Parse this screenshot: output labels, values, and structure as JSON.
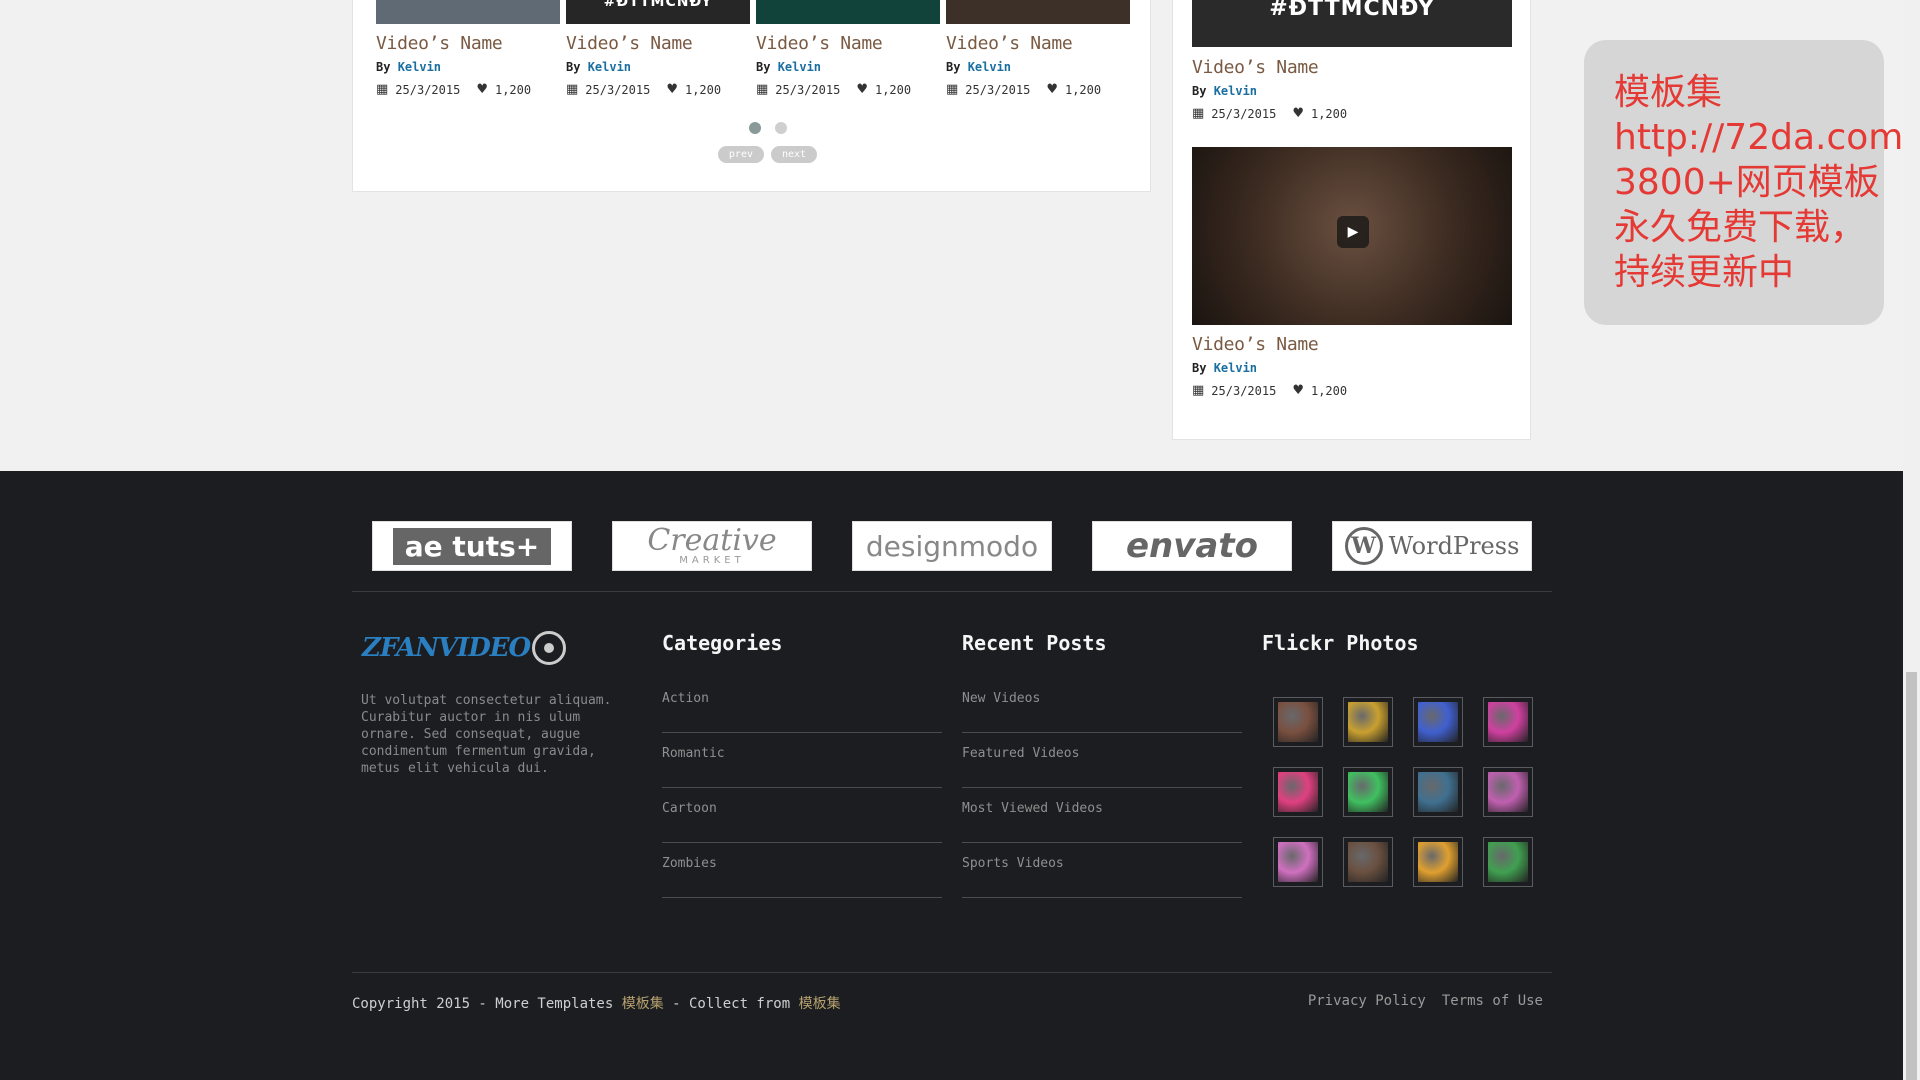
{
  "videos": [
    {
      "name": "Video’s Name",
      "by": "By",
      "author": "Kelvin",
      "date": "25/3/2015",
      "likes": "1,200",
      "thumb_color": "#5f6a74",
      "tag": ""
    },
    {
      "name": "Video’s Name",
      "by": "By",
      "author": "Kelvin",
      "date": "25/3/2015",
      "likes": "1,200",
      "thumb_color": "#262626",
      "tag": "#ĐTTMCNĐY"
    },
    {
      "name": "Video’s Name",
      "by": "By",
      "author": "Kelvin",
      "date": "25/3/2015",
      "likes": "1,200",
      "thumb_color": "#11433b",
      "tag": ""
    },
    {
      "name": "Video’s Name",
      "by": "By",
      "author": "Kelvin",
      "date": "25/3/2015",
      "likes": "1,200",
      "thumb_color": "#3c3028",
      "tag": ""
    }
  ],
  "carousel": {
    "prev_label": "prev",
    "next_label": "next",
    "active_dot": 0
  },
  "sidebar_videos": [
    {
      "name": "Video’s Name",
      "by": "By",
      "author": "Kelvin",
      "date": "25/3/2015",
      "likes": "1,200",
      "thumb_color": "#2a2a2a",
      "tag": "#ĐTTMCNĐY"
    },
    {
      "name": "Video’s Name",
      "by": "By",
      "author": "Kelvin",
      "date": "25/3/2015",
      "likes": "1,200",
      "thumb_color": "#3b2a20",
      "tag": ""
    }
  ],
  "notice": {
    "text": "模板集 http://72da.com 3800+网页模板永久免费下载，持续更新中"
  },
  "partners": [
    "ae tuts+",
    "Creative",
    "MARKET",
    "designmodo",
    "envato",
    "WordPress"
  ],
  "footer": {
    "logo_text": "ZFANVIDEO",
    "about": "Ut volutpat consectetur aliquam. Curabitur auctor in nis ulum ornare. Sed consequat, augue condimentum fermentum gravida, metus elit vehicula dui.",
    "categories": {
      "title": "Categories",
      "items": [
        "Action",
        "Romantic",
        "Cartoon",
        "Zombies"
      ]
    },
    "recent_posts": {
      "title": "Recent Posts",
      "items": [
        "New Videos",
        "Featured Videos",
        "Most Viewed Videos",
        "Sports Videos"
      ]
    },
    "flickr": {
      "title": "Flickr Photos",
      "photo_colors": [
        "#7a5040",
        "#c9a030",
        "#4060d0",
        "#d040a0",
        "#e04080",
        "#40c060",
        "#407090",
        "#c060b0",
        "#d070c0",
        "#6a5040",
        "#e0a030",
        "#40a050"
      ]
    },
    "copyright_prefix": "Copyright 2015 - More Templates ",
    "copyright_site1": "模板集",
    "copyright_mid": " - Collect from ",
    "copyright_site2": "模板集",
    "privacy": "Privacy Policy",
    "terms": "Terms of Use"
  },
  "colors": {
    "accent_brown": "#7a5a43",
    "author_blue": "#1a6fa0",
    "footer_bg": "#1c1d21",
    "notice_red": "#e53935"
  }
}
